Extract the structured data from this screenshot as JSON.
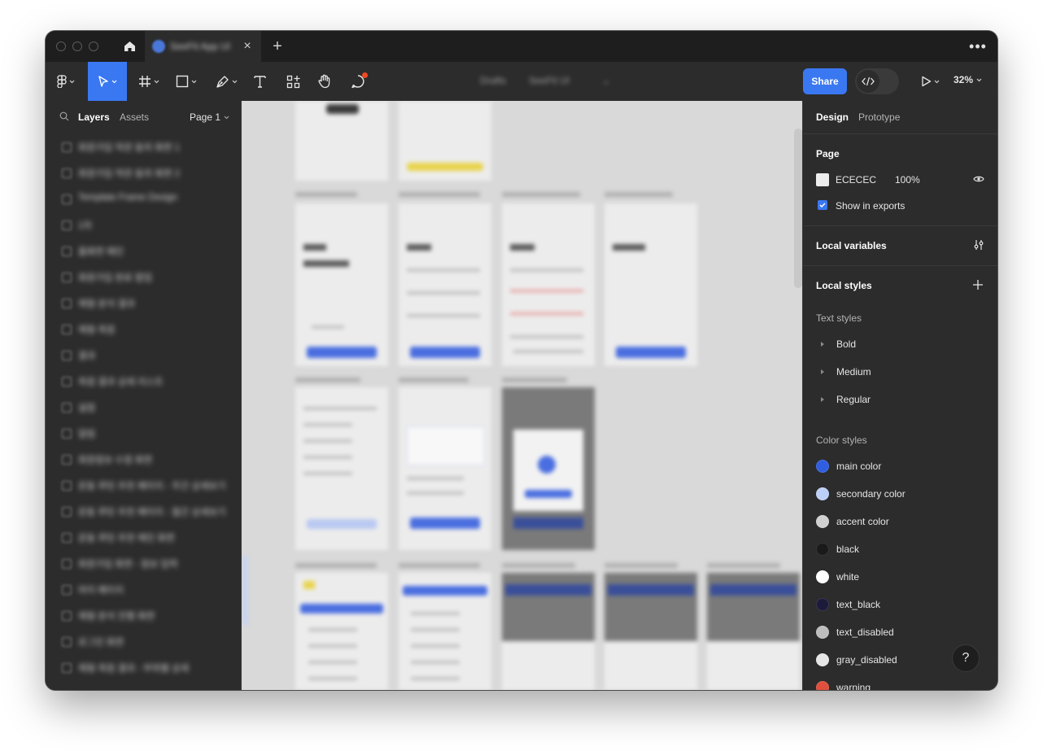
{
  "tabs": {
    "file_tab_title": "SeeFit App UI",
    "new_tab_symbol": "+",
    "close_symbol": "×",
    "more_symbol": "•••"
  },
  "toolbar": {
    "breadcrumb_team": "Drafts",
    "breadcrumb_file": "SeeFit UI",
    "share_label": "Share",
    "zoom_label": "32%"
  },
  "left_panel": {
    "tabs": [
      "Layers",
      "Assets"
    ],
    "page_selector": "Page 1",
    "layers": [
      "회원가입 약관 동의 화면 1",
      "회원가입 약관 동의 화면 2",
      "Template Frame Design",
      "1차",
      "홈화면 메인",
      "회원가입 완료 팝업",
      "체형 분석 결과",
      "체형 측정",
      "결과",
      "측정 결과 상세 리스트",
      "설정",
      "알림",
      "회원정보 수정 화면",
      "운동 루틴 추천 페이지 - 주간 상세보기",
      "운동 루틴 추천 페이지 - 월간 상세보기",
      "운동 루틴 추천 메인 화면",
      "회원가입 화면 - 정보 입력",
      "마이 페이지",
      "체형 분석 진행 화면",
      "로그인 화면",
      "체형 측정 결과 - 부위별 상세"
    ]
  },
  "right_panel": {
    "tabs": [
      "Design",
      "Prototype"
    ],
    "page": {
      "title": "Page",
      "color_hex": "ECECEC",
      "opacity": "100%",
      "show_in_exports": "Show in exports"
    },
    "local_variables": "Local variables",
    "local_styles": "Local styles",
    "text_styles_title": "Text styles",
    "text_styles": [
      "Bold",
      "Medium",
      "Regular"
    ],
    "color_styles_title": "Color styles",
    "color_styles": [
      {
        "name": "main color",
        "color": "#2f5ee0"
      },
      {
        "name": "secondary color",
        "color": "#bcd0f7"
      },
      {
        "name": "accent color",
        "color": "#d0d0d0"
      },
      {
        "name": "black",
        "color": "#1a1a1a"
      },
      {
        "name": "white",
        "color": "#ffffff"
      },
      {
        "name": "text_black",
        "color": "#1c1c3a"
      },
      {
        "name": "text_disabled",
        "color": "#bdbdbd"
      },
      {
        "name": "gray_disabled",
        "color": "#e6e6e6"
      },
      {
        "name": "warning",
        "color": "#e0503c"
      }
    ],
    "help_symbol": "?"
  },
  "colors": {
    "accent_blue": "#3a78f2",
    "titlebar_bg": "#1e1e1e",
    "panel_bg": "#2c2c2c",
    "canvas_bg": "#d9d9d9",
    "notification_dot": "#f24822"
  }
}
